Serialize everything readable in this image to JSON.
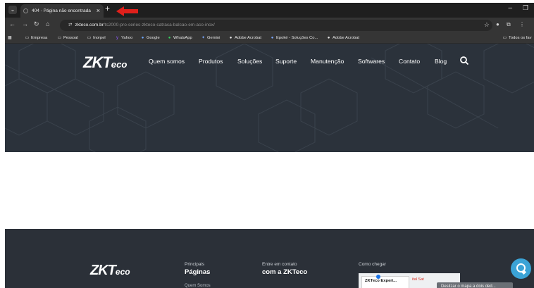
{
  "browser": {
    "tab_title": "404 - Página não encontrada",
    "tab_close": "×",
    "new_tab": "+",
    "minimize": "–",
    "maximize": "❐",
    "url_host": "zkteco.com.br",
    "url_path": "/ts2000-pro-series-zkteco-catraca-balcao-em-aco-inox/",
    "bookmarks": [
      {
        "label": "Empresa",
        "icon": "folder-icon"
      },
      {
        "label": "Pessoal",
        "icon": "folder-icon"
      },
      {
        "label": "Inorpel",
        "icon": "folder-icon"
      },
      {
        "label": "Yahoo",
        "icon": "yahoo-icon"
      },
      {
        "label": "Google",
        "icon": "google-icon"
      },
      {
        "label": "WhatsApp",
        "icon": "whatsapp-icon"
      },
      {
        "label": "Gemini",
        "icon": "gemini-icon"
      },
      {
        "label": "Adobe Acrobat",
        "icon": "acrobat-icon"
      },
      {
        "label": "Epoké - Soluções Co...",
        "icon": "site-icon"
      },
      {
        "label": "Adobe Acrobat",
        "icon": "acrobat-icon"
      }
    ],
    "all_bookmarks": "Todos os fav",
    "annotation_color": "#e0201b"
  },
  "site": {
    "logo_main": "ZKT",
    "logo_eco": "eco",
    "menu": [
      "Quem somos",
      "Produtos",
      "Soluções",
      "Suporte",
      "Manutenção",
      "Softwares",
      "Contato",
      "Blog"
    ],
    "header_color": "#2b323b",
    "footer_color": "#2b3038"
  },
  "footer": {
    "col1_small": "Principais",
    "col1_big": "Páginas",
    "col1_link": "Quem Somos",
    "col2_small": "Entre em contato",
    "col2_big": "com a ZKTeco",
    "col3_small": "Como chegar",
    "map_card": "ZKTeco Experi...",
    "map_road": "ital Sat",
    "toast": "Deslizar o mapa a dois ded..."
  }
}
